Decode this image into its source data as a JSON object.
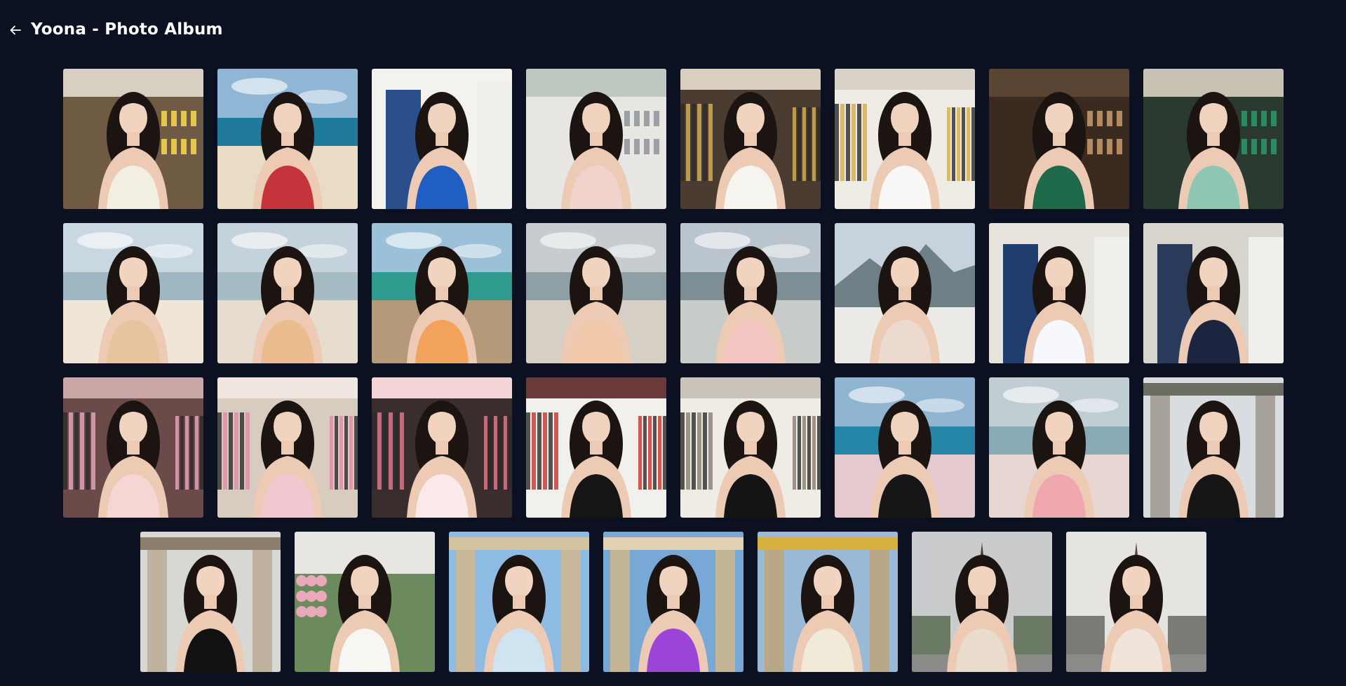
{
  "header": {
    "title": "Yoona - Photo Album",
    "back_icon": "arrow-left-icon"
  },
  "colors": {
    "background": "#0b1120",
    "title": "#ffffff"
  },
  "photos": [
    {
      "id": "p1",
      "scene": "bar-shelves",
      "bg": "#6f5a44",
      "sky": "#d8cfc3",
      "outfit": "#f2efe2",
      "accent": "#e5c84a"
    },
    {
      "id": "p2",
      "scene": "beach",
      "bg": "#e9dcc5",
      "sky": "#8fb6d4",
      "outfit": "#c5343a",
      "accent": "#1f7a9b"
    },
    {
      "id": "p3",
      "scene": "doorway",
      "bg": "#f4f2ee",
      "sky": "#2a4f8a",
      "outfit": "#1f5fc2",
      "accent": "#8aa9c9"
    },
    {
      "id": "p4",
      "scene": "kitchen",
      "bg": "#e8e6e2",
      "sky": "#bfc9c2",
      "outfit": "#f1d2cd",
      "accent": "#9aa0a3"
    },
    {
      "id": "p5",
      "scene": "boutique",
      "bg": "#4a3c30",
      "sky": "#d9cfc1",
      "outfit": "#f6f4ef",
      "accent": "#d8b35a"
    },
    {
      "id": "p6",
      "scene": "boutique",
      "bg": "#efece6",
      "sky": "#d9d2c8",
      "outfit": "#f9f8f6",
      "accent": "#d6ad4c"
    },
    {
      "id": "p7",
      "scene": "restaurant",
      "bg": "#3a2a20",
      "sky": "#5a4434",
      "outfit": "#1f6a4a",
      "accent": "#b58a63"
    },
    {
      "id": "p8",
      "scene": "restaurant",
      "bg": "#2b3a30",
      "sky": "#c8c2b4",
      "outfit": "#8fc7b4",
      "accent": "#2a8a60"
    },
    {
      "id": "p9",
      "scene": "beach",
      "bg": "#efe6d7",
      "sky": "#c9d7e0",
      "outfit": "#e5c49e",
      "accent": "#9fb7c2"
    },
    {
      "id": "p10",
      "scene": "beach",
      "bg": "#e6ddd0",
      "sky": "#c4d2db",
      "outfit": "#ebbd8e",
      "accent": "#a6bcc5"
    },
    {
      "id": "p11",
      "scene": "beach",
      "bg": "#b49a7a",
      "sky": "#9cc0d8",
      "outfit": "#f2a25a",
      "accent": "#2f9a8e"
    },
    {
      "id": "p12",
      "scene": "beach",
      "bg": "#d6cfc5",
      "sky": "#c6ccd0",
      "outfit": "#f0c9ab",
      "accent": "#8f9fa6"
    },
    {
      "id": "p13",
      "scene": "beach",
      "bg": "#c8ccc9",
      "sky": "#b9c4cc",
      "outfit": "#f3c6c1",
      "accent": "#7d8e95"
    },
    {
      "id": "p14",
      "scene": "mountains",
      "bg": "#5c6e5a",
      "sky": "#c7d3dc",
      "outfit": "#ecd9cf",
      "accent": "#2a2a2a"
    },
    {
      "id": "p15",
      "scene": "hallway",
      "bg": "#e6e3dc",
      "sky": "#1f3c6e",
      "outfit": "#f7f8fb",
      "accent": "#3b5fb0"
    },
    {
      "id": "p16",
      "scene": "hallway",
      "bg": "#d7d4ce",
      "sky": "#2a3a5a",
      "outfit": "#1b2540",
      "accent": "#e07a2a"
    },
    {
      "id": "p17",
      "scene": "shop-pink",
      "bg": "#6b4a4a",
      "sky": "#c9a7a7",
      "outfit": "#f6d6d4",
      "accent": "#e6a9c3"
    },
    {
      "id": "p18",
      "scene": "shop-pink",
      "bg": "#d8cbbf",
      "sky": "#efe7df",
      "outfit": "#f2c7cf",
      "accent": "#e08aa6"
    },
    {
      "id": "p19",
      "scene": "shop-pink",
      "bg": "#3a2d2d",
      "sky": "#f3d5d8",
      "outfit": "#fbe9ea",
      "accent": "#e57a8e"
    },
    {
      "id": "p20",
      "scene": "closet",
      "bg": "#f2f0ec",
      "sky": "#6a3a3a",
      "outfit": "#151515",
      "accent": "#c9302c"
    },
    {
      "id": "p21",
      "scene": "closet",
      "bg": "#efece6",
      "sky": "#c9c2b8",
      "outfit": "#141414",
      "accent": "#8a7d70"
    },
    {
      "id": "p22",
      "scene": "beach",
      "bg": "#e4c9cf",
      "sky": "#8fb5d1",
      "outfit": "#161616",
      "accent": "#2585a6"
    },
    {
      "id": "p23",
      "scene": "beach",
      "bg": "#e8d6d3",
      "sky": "#c0cdd3",
      "outfit": "#f0a6ae",
      "accent": "#8aaab5"
    },
    {
      "id": "p24",
      "scene": "temple",
      "bg": "#a7a39b",
      "sky": "#d9dde0",
      "outfit": "#161616",
      "accent": "#6b6d62"
    },
    {
      "id": "p25",
      "scene": "ruins",
      "bg": "#bfb39f",
      "sky": "#d7d8d4",
      "outfit": "#121212",
      "accent": "#8a7e6a"
    },
    {
      "id": "p26",
      "scene": "garden",
      "bg": "#6b8a5e",
      "sky": "#e7e6e3",
      "outfit": "#f8f6f2",
      "accent": "#e9a9b9"
    },
    {
      "id": "p27",
      "scene": "ruins",
      "bg": "#c8b79a",
      "sky": "#8dbbe3",
      "outfit": "#cfe3f1",
      "accent": "#d5c29f"
    },
    {
      "id": "p28",
      "scene": "ruins",
      "bg": "#c4b496",
      "sky": "#78a8d6",
      "outfit": "#9a44d8",
      "accent": "#e2d2b2"
    },
    {
      "id": "p29",
      "scene": "ruins",
      "bg": "#b9a888",
      "sky": "#9ab9d6",
      "outfit": "#f1ead8",
      "accent": "#d8b040"
    },
    {
      "id": "p30",
      "scene": "eiffel",
      "bg": "#6a7a64",
      "sky": "#c9cbcd",
      "outfit": "#e9dccc",
      "accent": "#4a4238"
    },
    {
      "id": "p31",
      "scene": "eiffel",
      "bg": "#7b7a74",
      "sky": "#e6e4e0",
      "outfit": "#f0e4da",
      "accent": "#5a4a3a"
    }
  ],
  "rows": [
    8,
    8,
    8,
    7
  ]
}
